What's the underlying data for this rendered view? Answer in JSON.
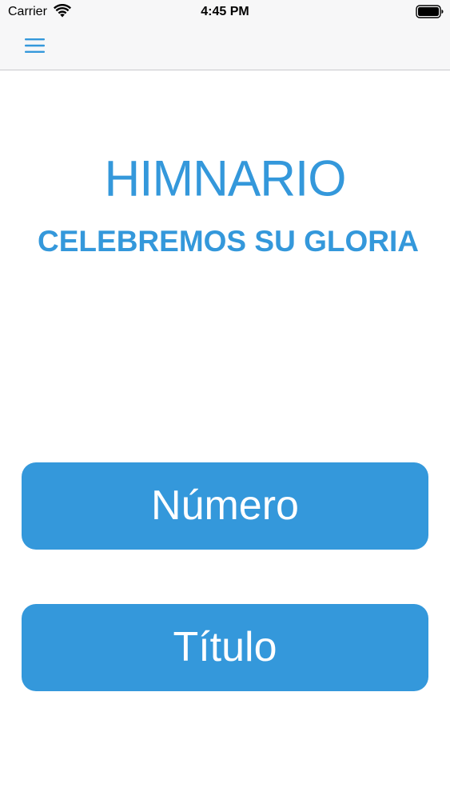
{
  "status_bar": {
    "carrier": "Carrier",
    "time": "4:45 PM",
    "wifi_icon": "wifi-icon",
    "battery_icon": "battery-icon"
  },
  "nav_bar": {
    "menu_icon": "hamburger-menu-icon"
  },
  "main": {
    "title": "HIMNARIO",
    "subtitle": "CELEBREMOS SU GLORIA",
    "buttons": [
      {
        "label": "Número"
      },
      {
        "label": "Título"
      }
    ]
  },
  "colors": {
    "accent": "#3498db",
    "bar_background": "#f7f7f8"
  }
}
